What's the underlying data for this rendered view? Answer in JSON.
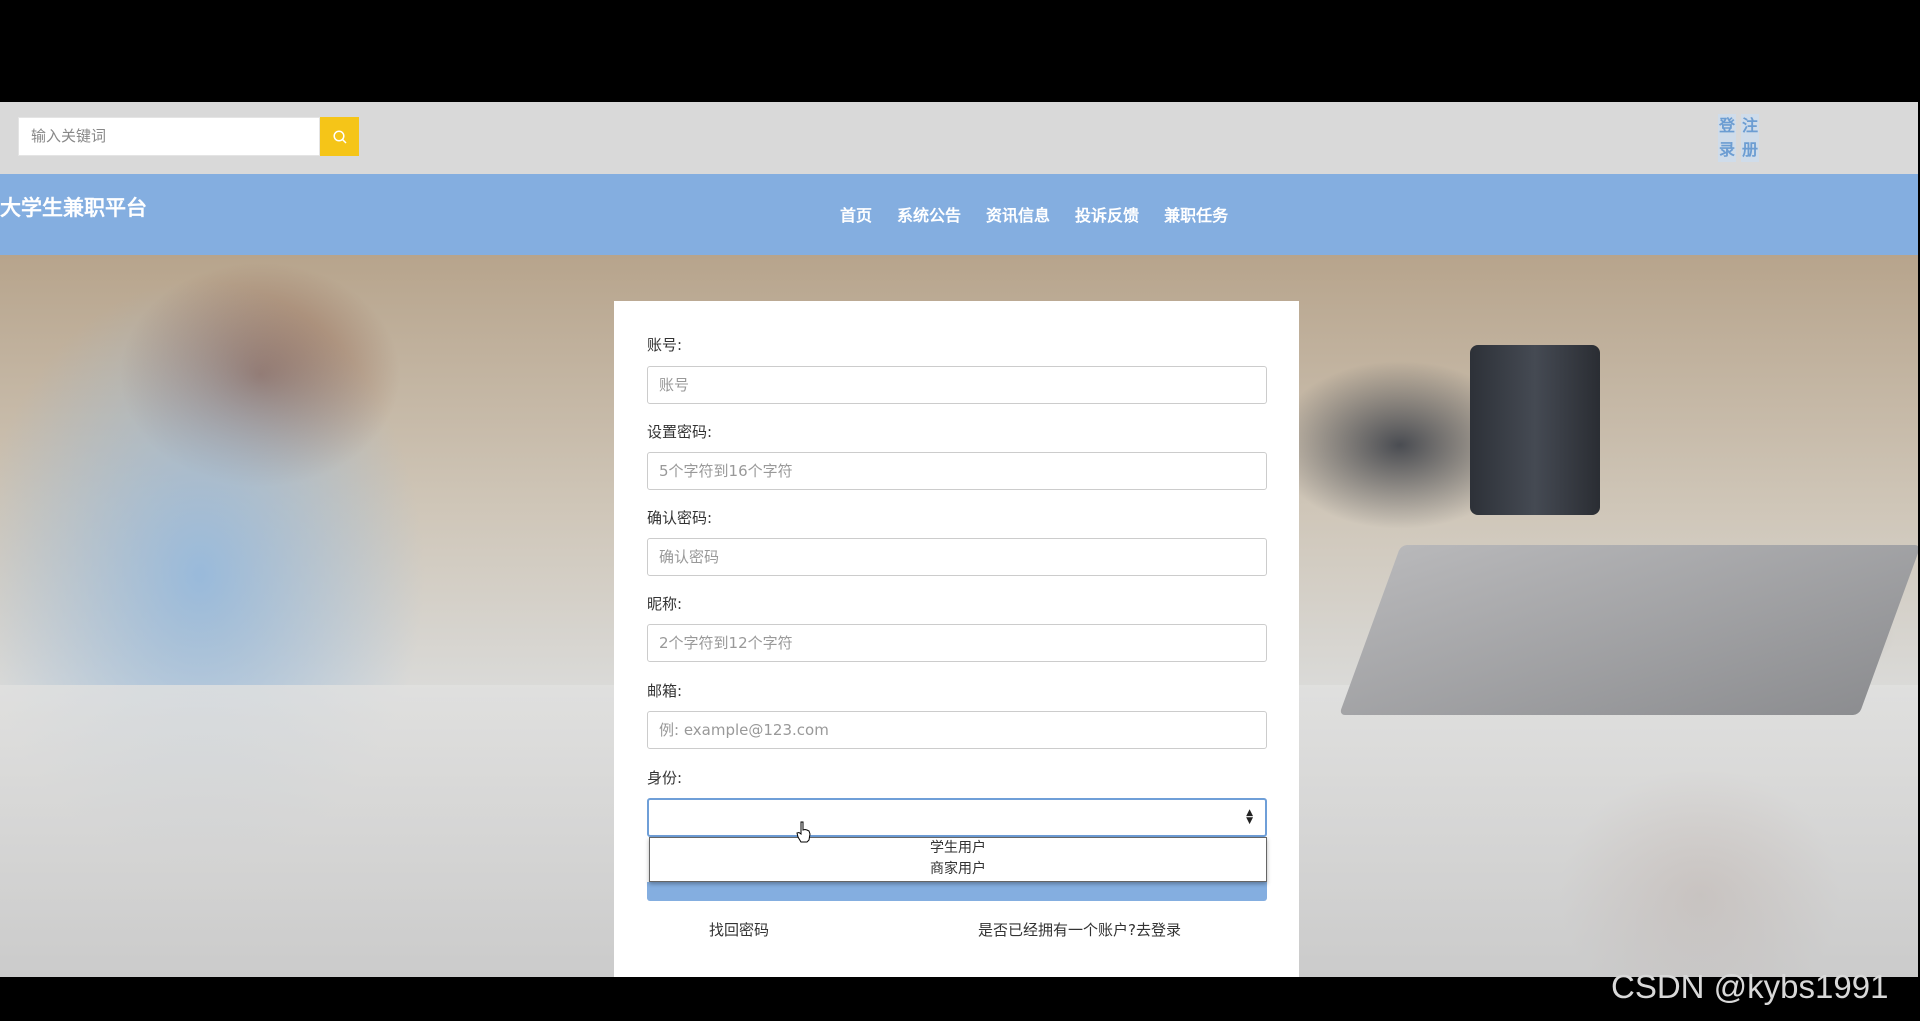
{
  "search": {
    "placeholder": "输入关键词"
  },
  "auth": {
    "login": "登录",
    "register": "注册"
  },
  "brand": "大学生兼职平台",
  "nav": [
    "首页",
    "系统公告",
    "资讯信息",
    "投诉反馈",
    "兼职任务"
  ],
  "form": {
    "account_label": "账号:",
    "account_placeholder": "账号",
    "password_label": "设置密码:",
    "password_placeholder": "5个字符到16个字符",
    "confirm_label": "确认密码:",
    "confirm_placeholder": "确认密码",
    "nickname_label": "昵称:",
    "nickname_placeholder": "2个字符到12个字符",
    "email_label": "邮箱:",
    "email_placeholder": "例: example@123.com",
    "identity_label": "身份:",
    "identity_value": "",
    "identity_options": [
      "学生用户",
      "商家用户"
    ],
    "forgot_link": "找回密码",
    "login_link": "是否已经拥有一个账户?去登录"
  },
  "watermark": "CSDN @kybs1991",
  "colors": {
    "nav_bg": "#84aee0",
    "search_btn": "#f5c518",
    "topbar_bg": "#d9d9d9"
  },
  "icons": {
    "search": "search-icon"
  }
}
